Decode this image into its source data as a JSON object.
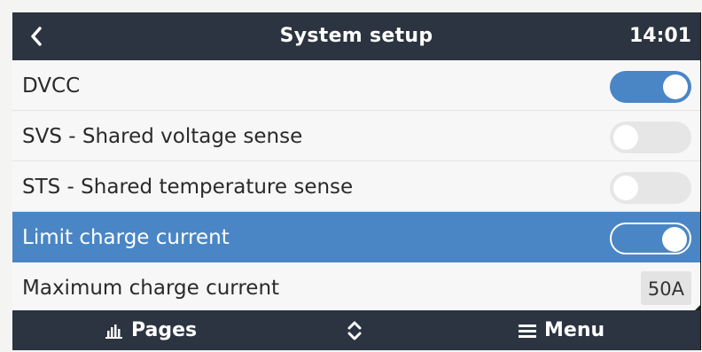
{
  "header": {
    "title": "System setup",
    "time": "14:01",
    "back_icon": "chevron-left-icon"
  },
  "rows": [
    {
      "label": "DVCC",
      "control": "toggle",
      "on": true
    },
    {
      "label": "SVS - Shared voltage sense",
      "control": "toggle",
      "on": false
    },
    {
      "label": "STS - Shared temperature sense",
      "control": "toggle",
      "on": false
    },
    {
      "label": "Limit charge current",
      "control": "toggle",
      "on": true,
      "selected": true
    },
    {
      "label": "Maximum charge current",
      "control": "value",
      "value": "50A"
    }
  ],
  "footer": {
    "pages_label": "Pages",
    "pages_icon": "bar-chart-icon",
    "nav_icon": "up-down-chevron-icon",
    "menu_label": "Menu",
    "menu_icon": "hamburger-icon"
  },
  "colors": {
    "header_bg": "#2b3440",
    "accent": "#4a86c5",
    "row_bg": "#f7f7f7",
    "toggle_off": "#e6e6e6"
  }
}
